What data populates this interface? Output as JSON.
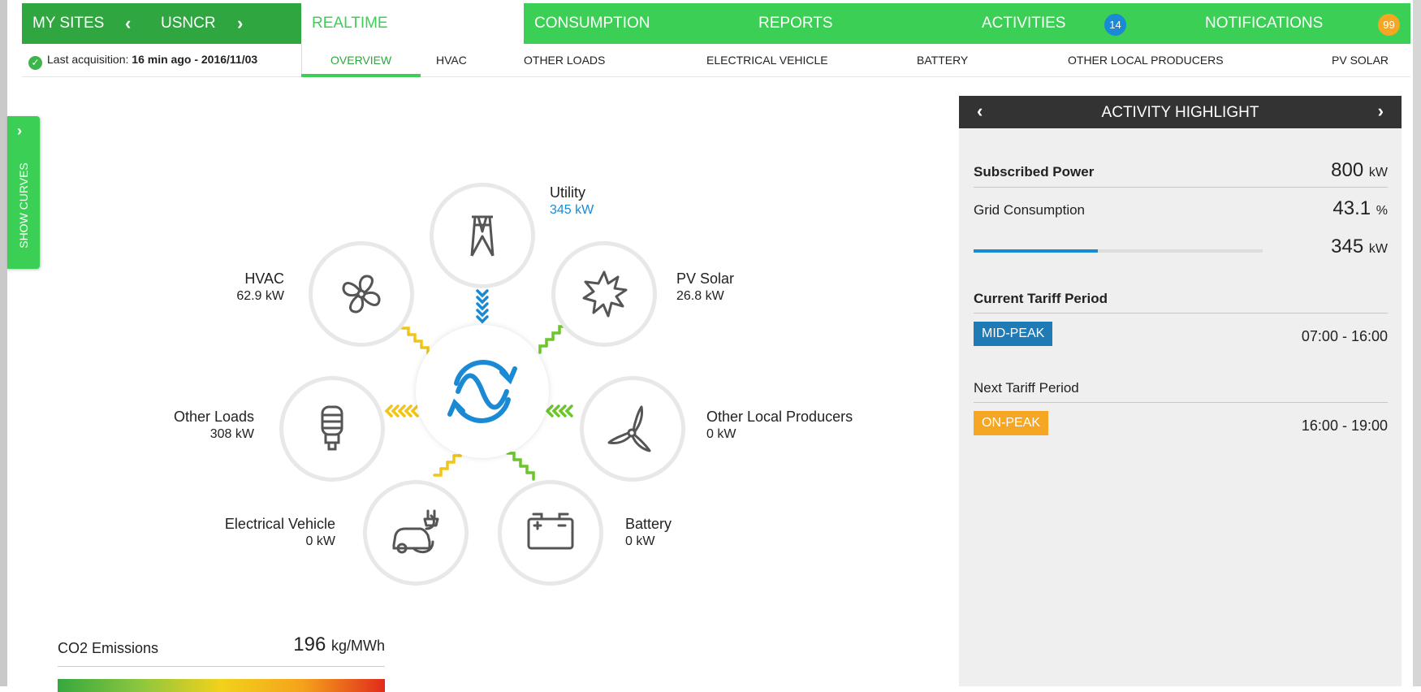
{
  "nav": {
    "my_sites": "MY SITES",
    "site": "USNCR",
    "realtime": "REALTIME",
    "consumption": "CONSUMPTION",
    "reports": "REPORTS",
    "activities": "ACTIVITIES",
    "activities_count": "14",
    "notifications": "NOTIFICATIONS",
    "notifications_count": "99"
  },
  "subnav": {
    "acq_label": "Last acquisition:",
    "acq_value": "16 min ago - 2016/11/03",
    "tabs": [
      "OVERVIEW",
      "HVAC",
      "OTHER LOADS",
      "ELECTRICAL VEHICLE",
      "BATTERY",
      "OTHER LOCAL PRODUCERS",
      "PV SOLAR"
    ]
  },
  "show_curves": "SHOW CURVES",
  "nodes": {
    "utility": {
      "name": "Utility",
      "value": "345 kW"
    },
    "hvac": {
      "name": "HVAC",
      "value": "62.9 kW"
    },
    "pv_solar": {
      "name": "PV Solar",
      "value": "26.8 kW"
    },
    "other_loads": {
      "name": "Other Loads",
      "value": "308 kW"
    },
    "other_producers": {
      "name": "Other Local Producers",
      "value": "0 kW"
    },
    "ev": {
      "name": "Electrical Vehicle",
      "value": "0 kW"
    },
    "battery": {
      "name": "Battery",
      "value": "0 kW"
    }
  },
  "co2": {
    "title": "CO2 Emissions",
    "value": "196",
    "unit": "kg/MWh"
  },
  "activity": {
    "title": "ACTIVITY HIGHLIGHT",
    "subscribed_label": "Subscribed Power",
    "subscribed_value": "800",
    "subscribed_unit": "kW",
    "grid_label": "Grid Consumption",
    "grid_pct": "43.1",
    "grid_pct_unit": "%",
    "grid_fraction": 0.431,
    "grid_kw": "345",
    "grid_kw_unit": "kW",
    "current_label": "Current Tariff Period",
    "current_tag": "MID-PEAK",
    "current_time": "07:00 - 16:00",
    "next_label": "Next Tariff Period",
    "next_tag": "ON-PEAK",
    "next_time": "16:00 - 19:00"
  },
  "colors": {
    "nav_green": "#3ccf55",
    "dark_green": "#2fa63f",
    "blue": "#1a8ad4",
    "yellow": "#f0c419",
    "orange": "#f5a623",
    "mid_peak": "#1f7bb5",
    "on_peak": "#f5a623"
  }
}
